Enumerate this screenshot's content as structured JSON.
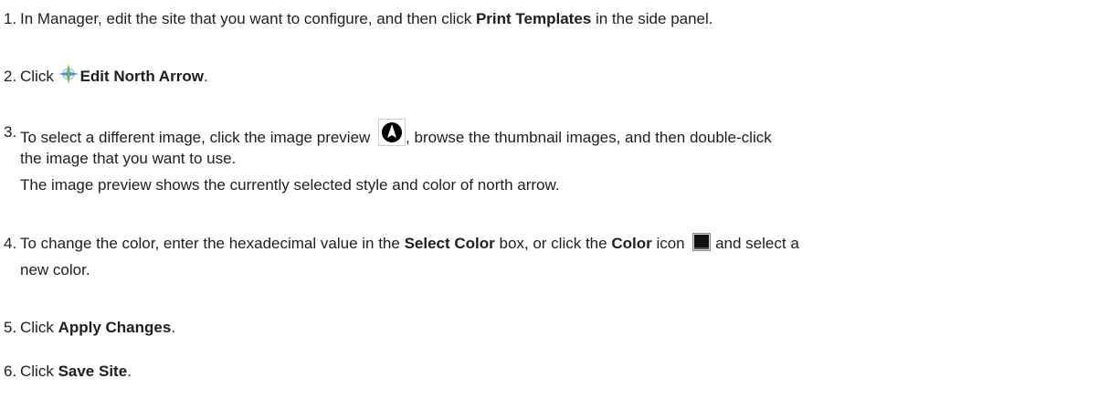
{
  "steps": [
    {
      "num": "1.",
      "t1": "In Manager, edit the site that you want to configure, and then click ",
      "b1": "Print Templates",
      "t2": " in the side panel."
    },
    {
      "num": "2.",
      "t1": "Click ",
      "b1": "Edit North Arrow",
      "t2": ".",
      "icon": "compass-icon"
    },
    {
      "num": "3.",
      "t1": "To select a different image, click the image preview ",
      "t2": ", browse the thumbnail images, and then double-click",
      "t3": "the image that you want to use.",
      "t4": "The image preview shows the currently selected style and color of north arrow.",
      "icon": "north-arrow-preview-icon"
    },
    {
      "num": "4.",
      "t1": "To change the color, enter the hexadecimal value in the ",
      "b1": "Select Color",
      "t2": " box, or click the ",
      "b2": "Color",
      "t3": " icon ",
      "t4": "and select a",
      "t5": "new color.",
      "icon": "color-icon"
    },
    {
      "num": "5.",
      "t1": "Click ",
      "b1": "Apply Changes",
      "t2": "."
    },
    {
      "num": "6.",
      "t1": "Click ",
      "b1": "Save Site",
      "t2": "."
    }
  ],
  "colors": {
    "text": "#1e1e1e",
    "compass_green": "#6fb84a",
    "compass_blue": "#4a8fd6"
  }
}
